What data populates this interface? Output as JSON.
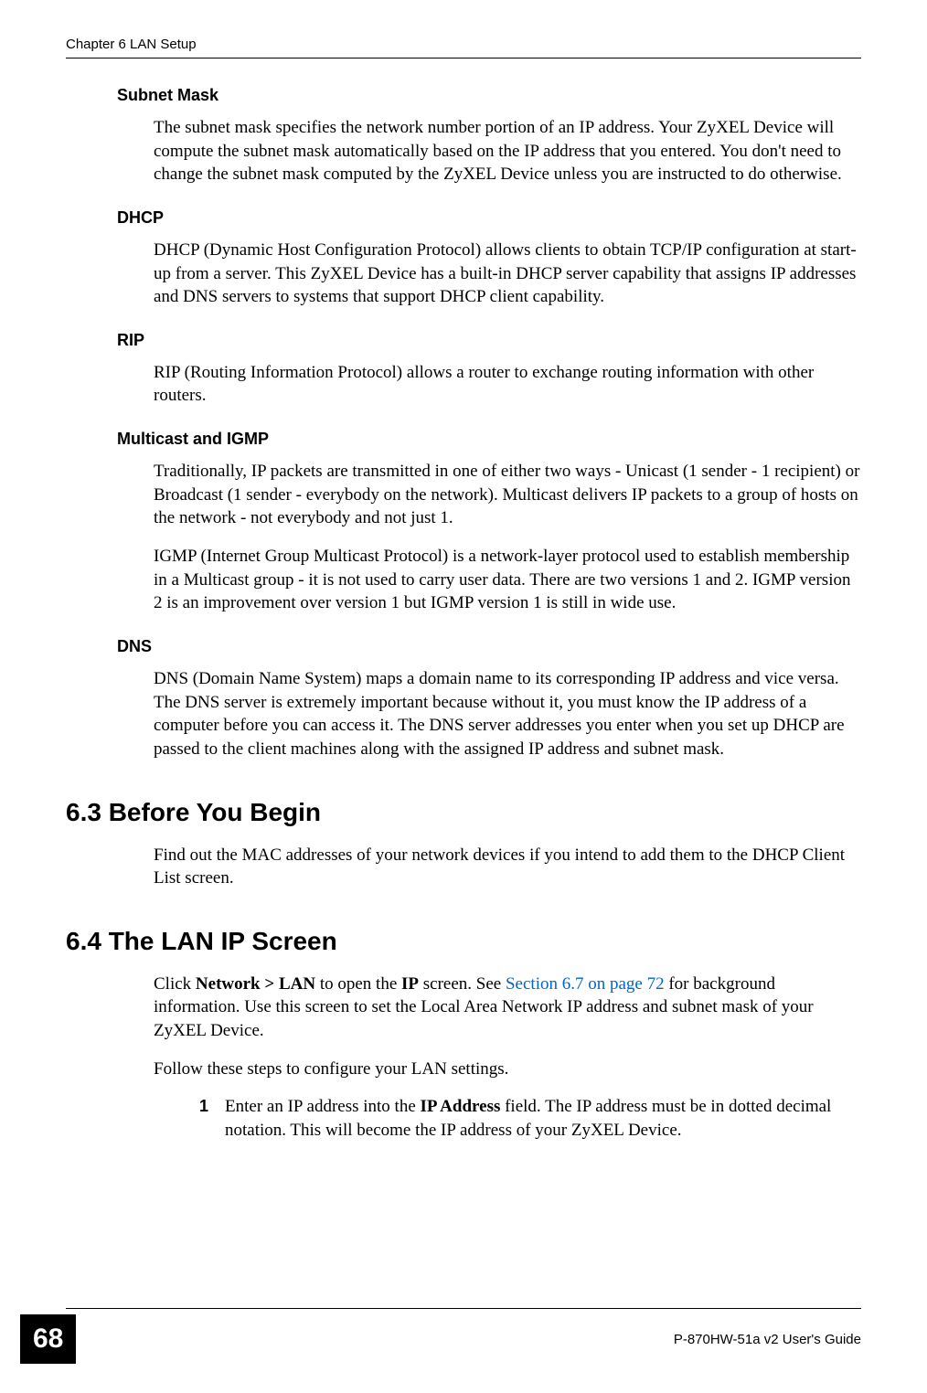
{
  "header": {
    "chapter": "Chapter 6 LAN Setup"
  },
  "sections": {
    "subnet_mask": {
      "title": "Subnet Mask",
      "p1": "The subnet mask specifies the network number portion of an IP address. Your ZyXEL Device will compute the subnet mask automatically based on the IP address that you entered. You don't need to change the subnet mask computed by the ZyXEL Device unless you are instructed to do otherwise."
    },
    "dhcp": {
      "title": "DHCP",
      "p1": "DHCP (Dynamic Host Configuration Protocol) allows clients to obtain TCP/IP configuration at start-up from a server. This ZyXEL Device has a built-in DHCP server capability that assigns IP addresses and DNS servers to systems that support DHCP client capability."
    },
    "rip": {
      "title": "RIP",
      "p1": "RIP (Routing Information Protocol) allows a router to exchange routing information with other routers."
    },
    "multicast": {
      "title": "Multicast and IGMP",
      "p1": "Traditionally, IP packets are transmitted in one of either two ways - Unicast (1 sender - 1 recipient) or Broadcast (1 sender - everybody on the network). Multicast delivers IP packets to a group of hosts on the network - not everybody and not just 1.",
      "p2": "IGMP (Internet Group Multicast Protocol) is a network-layer protocol used to establish membership in a Multicast group - it is not used to carry user data. There are two versions 1 and 2. IGMP version 2 is an improvement over version 1 but IGMP version 1 is still in wide use."
    },
    "dns": {
      "title": "DNS",
      "p1": "DNS (Domain Name System) maps a domain name to its corresponding IP address and vice versa. The DNS server is extremely important because without it, you must know the IP address of a computer before you can access it. The DNS server addresses you enter when you set up DHCP are passed to the client machines along with the assigned IP address and subnet mask."
    },
    "before_begin": {
      "title": "6.3  Before You Begin",
      "p1": "Find out the MAC addresses of your network devices if you intend to add them to the DHCP Client List screen."
    },
    "lan_ip": {
      "title": "6.4  The LAN IP Screen",
      "p1_pre": "Click ",
      "p1_bold1": "Network > LAN",
      "p1_mid1": " to open the ",
      "p1_bold2": "IP",
      "p1_mid2": " screen. See ",
      "p1_link": "Section 6.7 on page 72",
      "p1_post": " for background information. Use this screen to set the Local Area Network IP address and subnet mask of your ZyXEL Device.",
      "p2": "Follow these steps to configure your LAN settings.",
      "step1_num": "1",
      "step1_pre": "Enter an IP address into the ",
      "step1_bold": "IP Address",
      "step1_post": " field. The IP address must be in dotted decimal notation. This will become the IP address of your ZyXEL Device."
    }
  },
  "footer": {
    "page_num": "68",
    "guide_label": "P-870HW-51a v2 User's Guide"
  }
}
